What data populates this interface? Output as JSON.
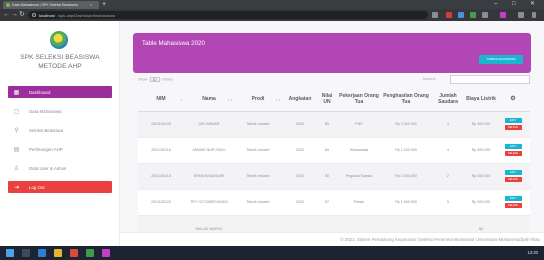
{
  "browser": {
    "tab_title": "Data Mahasiswa | SPK Seleksi Beasiswa",
    "url_host": "localhost",
    "url_path": "/spk-ahp/Dashboard/mahasiswa"
  },
  "sidebar": {
    "brand_line1": "SPK SELEKSI BEASISWA",
    "brand_line2": "METODE AHP",
    "items": [
      {
        "label": "Dashboard",
        "icon": "dashboard-icon",
        "active": true
      },
      {
        "label": "Data Mahasiswa",
        "icon": "document-icon",
        "active": false
      },
      {
        "label": "Seleksi Beasiswa",
        "icon": "search-icon",
        "active": false
      },
      {
        "label": "Perhitungan AHP",
        "icon": "grid-icon",
        "active": false
      },
      {
        "label": "Data User & Admin",
        "icon": "user-icon",
        "active": false
      },
      {
        "label": "Log Out",
        "icon": "logout-icon",
        "active": false
      }
    ]
  },
  "main": {
    "card_title": "Table Mahasiswa 2020",
    "add_button": "TAMBAH MAHASISWA",
    "show_label": "Show",
    "show_value": "10",
    "entries_label": "entries",
    "search_label": "Search:",
    "columns": [
      "NIM",
      "Nama",
      "Prodi",
      "Angkatan",
      "Nilai UN",
      "Pekerjaan Orang Tua",
      "Penghasilan Orang Tua",
      "Jumlah Saudara",
      "Biaya Listrik",
      ""
    ],
    "edit_label": "EDIT",
    "delete_label": "DELETE",
    "rows": [
      {
        "nim": "2001100106",
        "nama": "DIKI ANWAR",
        "prodi": "Teknik Industri",
        "angkatan": "2020",
        "nilai": "85",
        "pekerjaan": "PNS",
        "penghasilan": "Rp 3.000.000",
        "saudara": "3",
        "listrik": "Rp 400.000"
      },
      {
        "nim": "2001100116",
        "nama": "ANWAR NUR FADLI",
        "prodi": "Teknik Industri",
        "angkatan": "2020",
        "nilai": "84",
        "pekerjaan": "Wiraswasta",
        "penghasilan": "Rp 1.200.000",
        "saudara": "4",
        "listrik": "Rp 300.000"
      },
      {
        "nim": "2001100118",
        "nama": "ERMA KINANDARI",
        "prodi": "Teknik Industri",
        "angkatan": "2020",
        "nilai": "80",
        "pekerjaan": "Pegawai Swasta",
        "penghasilan": "Rp 2.500.000",
        "saudara": "2",
        "listrik": "Rp 450.000"
      },
      {
        "nim": "2001100120",
        "nama": "TRY OCTOBERYANDA",
        "prodi": "Teknik Industri",
        "angkatan": "2020",
        "nilai": "87",
        "pekerjaan": "Petani",
        "penghasilan": "Rp 1.000.000",
        "saudara": "5",
        "listrik": "Rp 200.000"
      }
    ],
    "partial_row": {
      "nama": "WALAD WAHYU",
      "listrik": "Rp"
    }
  },
  "footer": {
    "text": "© 2021, Sistem Pendukung Keputusan (Seleksi Penerima Beasiswa) Universitas Muhammadiyah Riau"
  },
  "taskbar": {
    "clock": "14:20"
  },
  "colors": {
    "primary": "#9b2d9c",
    "header": "#b146b4",
    "info": "#19b6d2",
    "danger": "#e8413f"
  }
}
